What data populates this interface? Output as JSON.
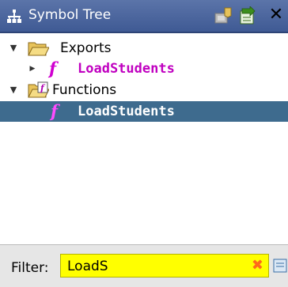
{
  "window": {
    "title": "Symbol Tree",
    "close_glyph": "✕"
  },
  "toolbar": {
    "icons": [
      "create-class-icon",
      "navigate-icon"
    ]
  },
  "tree": {
    "nodes": [
      {
        "label": "Exports",
        "type": "folder",
        "expanded": true
      },
      {
        "label": "LoadStudents",
        "type": "function",
        "fn_glyph": "f"
      },
      {
        "label": "Functions",
        "type": "folder",
        "expanded": true
      },
      {
        "label": "LoadStudents",
        "type": "function",
        "fn_glyph": "f",
        "selected": true
      }
    ]
  },
  "filter": {
    "label": "Filter:",
    "value": "LoadS",
    "clear_glyph": "✖"
  },
  "colors": {
    "titlebar": "#4c659e",
    "selection": "#3e6b8e",
    "function_label": "#c000c0",
    "filter_field": "#ffff00"
  }
}
